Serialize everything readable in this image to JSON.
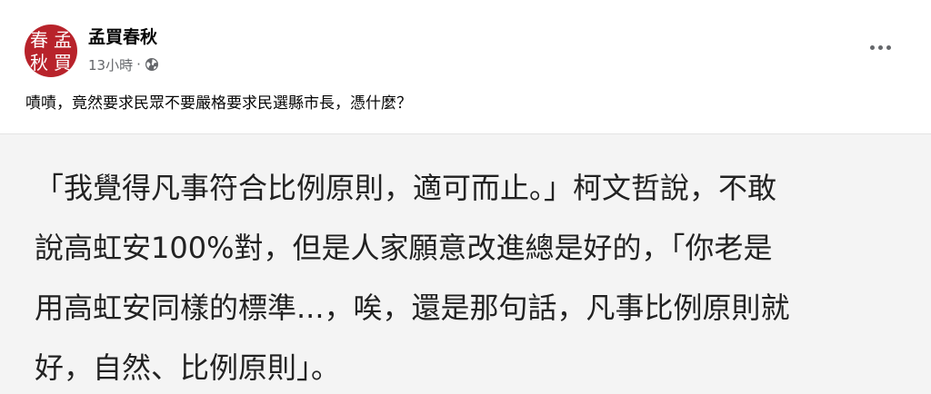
{
  "post": {
    "avatar_text": [
      "春",
      "孟",
      "秋",
      "買"
    ],
    "author": "孟買春秋",
    "time": "13小時",
    "separator": "·",
    "privacy_icon": "globe-icon",
    "more_icon": "more-options-icon",
    "caption": "嘖嘖，竟然要求民眾不要嚴格要求民選縣市長，憑什麼？"
  },
  "image": {
    "lines": [
      "「我覺得凡事符合比例原則，適可而止。」柯文哲說，不敢",
      "說高虹安100%對，但是人家願意改進總是好的，「你老是",
      "用高虹安同樣的標準...，唉，還是那句話，凡事比例原則就",
      "好，自然、比例原則」。"
    ]
  },
  "colors": {
    "avatar_bg": "#b8232b",
    "secondary_text": "#65676b",
    "primary_text": "#050505",
    "image_bg": "#f4f4f4"
  }
}
